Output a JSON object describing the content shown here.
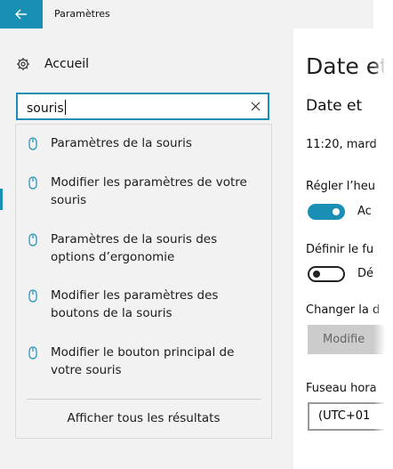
{
  "window": {
    "title": "Paramètres"
  },
  "nav": {
    "home_label": "Accueil"
  },
  "search": {
    "value": "souris",
    "suggestions": [
      {
        "label": "Paramètres de la souris",
        "icon": "mouse-icon"
      },
      {
        "label": "Modifier les paramètres de votre souris",
        "icon": "mouse-icon"
      },
      {
        "label": "Paramètres de la souris des options d’ergonomie",
        "icon": "mouse-icon"
      },
      {
        "label": "Modifier les paramètres des boutons de la souris",
        "icon": "mouse-icon"
      },
      {
        "label": "Modifier le bouton principal de votre souris",
        "icon": "mouse-icon"
      }
    ],
    "show_all_label": "Afficher tous les résultats"
  },
  "content": {
    "title": "Date et",
    "subtitle": "Date et",
    "time": "11:20, mard",
    "auto_time_label": "Régler l’heu",
    "auto_time_state": "Ac",
    "auto_tz_label": "Définir le fu",
    "auto_tz_state": "Dé",
    "change_label": "Changer la d",
    "change_button": "Modifie",
    "tz_label": "Fuseau hora",
    "tz_value": "(UTC+01"
  },
  "colors": {
    "accent": "#1a8fb5",
    "pane": "#f2f2f2"
  }
}
